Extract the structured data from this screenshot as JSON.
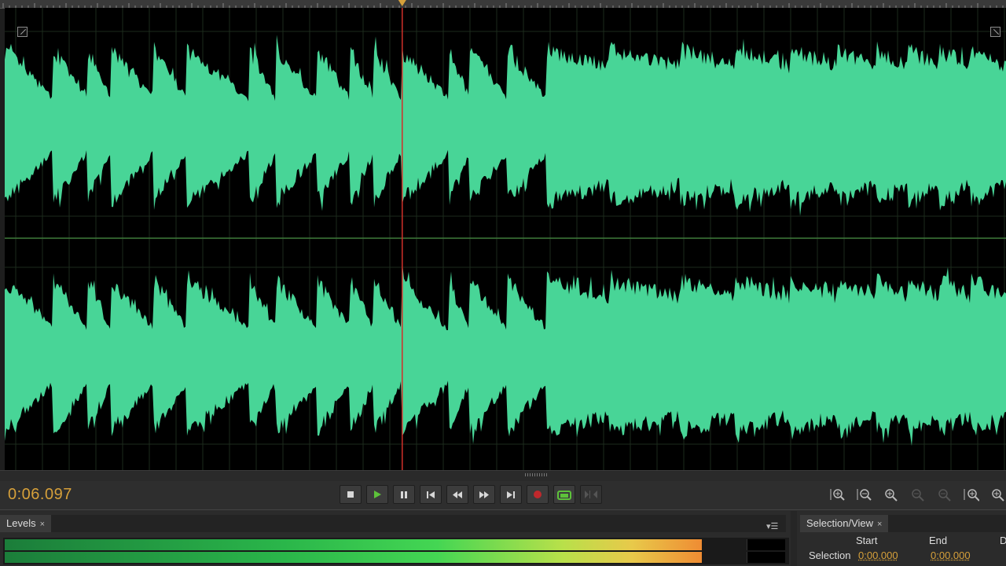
{
  "editor": {
    "waveform_color": "#48d597",
    "playhead_color": "#d0302a",
    "grid_color": "#2e4a2e",
    "center_line_color": "#3f7a3a",
    "channels": [
      "left",
      "right"
    ],
    "playhead_fraction": 0.397
  },
  "transport": {
    "current_time": "0:06.097",
    "buttons": [
      {
        "name": "stop-button",
        "icon": "stop-icon"
      },
      {
        "name": "play-button",
        "icon": "play-icon"
      },
      {
        "name": "pause-button",
        "icon": "pause-icon"
      },
      {
        "name": "move-to-previous-button",
        "icon": "skip-back-icon"
      },
      {
        "name": "rewind-button",
        "icon": "rewind-icon"
      },
      {
        "name": "fast-forward-button",
        "icon": "fast-forward-icon"
      },
      {
        "name": "move-to-next-button",
        "icon": "skip-forward-icon"
      },
      {
        "name": "record-button",
        "icon": "record-icon"
      },
      {
        "name": "loop-playback-button",
        "icon": "loop-icon"
      },
      {
        "name": "skip-selection-button",
        "icon": "skip-selection-icon",
        "disabled": true
      }
    ],
    "zoom_tools": [
      "zoom-in-amplitude-icon",
      "zoom-out-amplitude-icon",
      "zoom-in-time-icon",
      "zoom-out-time-icon",
      "zoom-out-full-icon",
      "zoom-in-at-start-icon",
      "zoom-in-at-end-icon"
    ],
    "accent_color": "#d6a03a",
    "play_color": "#5dc23a",
    "record_color": "#c0282c"
  },
  "levels_panel": {
    "tab_label": "Levels",
    "close_glyph": "×",
    "menu_glyph": "▾☰",
    "left_level": 0.94,
    "right_level": 0.94
  },
  "selection_panel": {
    "tab_label": "Selection/View",
    "close_glyph": "×",
    "col_start": "Start",
    "col_end": "End",
    "col_duration": "D",
    "row_label": "Selection",
    "start_value": "0:00.000",
    "end_value": "0:00.000"
  }
}
